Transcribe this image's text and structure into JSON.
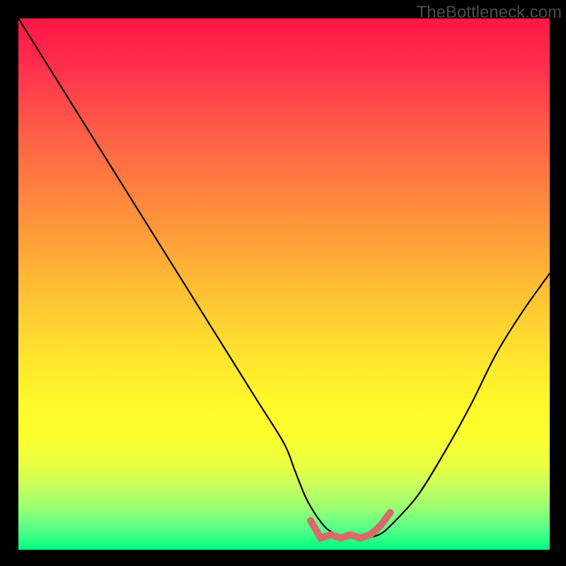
{
  "watermark": "TheBottleneck.com",
  "chart_data": {
    "type": "line",
    "title": "",
    "xlabel": "",
    "ylabel": "",
    "xlim": [
      0,
      100
    ],
    "ylim": [
      0,
      100
    ],
    "series": [
      {
        "name": "curve",
        "x": [
          0,
          5,
          10,
          15,
          20,
          25,
          30,
          35,
          40,
          45,
          50,
          52,
          54,
          56,
          58,
          60,
          62,
          64,
          66,
          68,
          70,
          75,
          80,
          85,
          90,
          95,
          100
        ],
        "values": [
          100,
          92,
          84,
          76,
          68,
          60,
          52,
          44,
          36,
          28,
          20,
          15,
          10,
          6.5,
          4.0,
          2.8,
          2.3,
          2.2,
          2.3,
          2.9,
          4.5,
          10,
          18,
          27,
          37,
          45,
          52
        ]
      }
    ],
    "flat_segment": {
      "name": "valley-marker",
      "color": "#d96a6a",
      "x_start": 55,
      "x_end": 70,
      "y": 2.5
    },
    "gradient_stops": [
      {
        "pos": 0,
        "color": "#ff1744"
      },
      {
        "pos": 50,
        "color": "#ffd030"
      },
      {
        "pos": 80,
        "color": "#fbff2c"
      },
      {
        "pos": 100,
        "color": "#00ff80"
      }
    ]
  }
}
